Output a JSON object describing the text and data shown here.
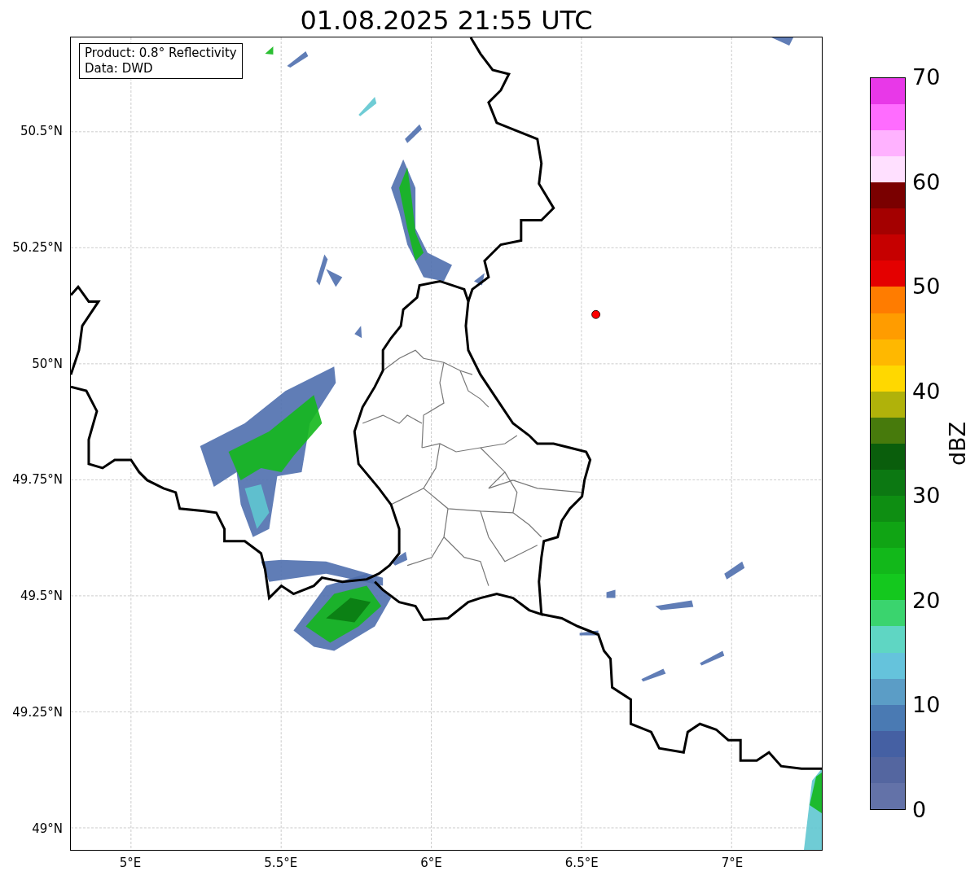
{
  "title": "01.08.2025 21:55 UTC",
  "legend": {
    "lines": [
      "Product: 0.8° Reflectivity",
      "Data: DWD"
    ]
  },
  "map": {
    "lat_labels": [
      "50.5°N",
      "50.25°N",
      "50°N",
      "49.75°N",
      "49.5°N",
      "49.25°N",
      "49°N"
    ],
    "lon_labels": [
      "5°E",
      "5.5°E",
      "6°E",
      "6.5°E",
      "7°E"
    ]
  },
  "colorbar": {
    "label": "dBZ",
    "ticks": [
      "70",
      "60",
      "50",
      "40",
      "30",
      "20",
      "10",
      "0"
    ],
    "bins": [
      {
        "color": "#6372a8"
      },
      {
        "color": "#5466a0"
      },
      {
        "color": "#4560a3"
      },
      {
        "color": "#4a7ab3"
      },
      {
        "color": "#5b9dc6"
      },
      {
        "color": "#65c3dc"
      },
      {
        "color": "#5fd6c3"
      },
      {
        "color": "#3ad46e"
      },
      {
        "color": "#14c81e"
      },
      {
        "color": "#12b81a"
      },
      {
        "color": "#10a414"
      },
      {
        "color": "#0e8e12"
      },
      {
        "color": "#0c7812"
      },
      {
        "color": "#0a5e0c"
      },
      {
        "color": "#477a0c"
      },
      {
        "color": "#b0b20a"
      },
      {
        "color": "#ffd800"
      },
      {
        "color": "#ffb800"
      },
      {
        "color": "#ff9c00"
      },
      {
        "color": "#ff7c00"
      },
      {
        "color": "#e40000"
      },
      {
        "color": "#c60000"
      },
      {
        "color": "#a40000"
      },
      {
        "color": "#7a0000"
      },
      {
        "color": "#ffe0ff"
      },
      {
        "color": "#ffb2ff"
      },
      {
        "color": "#ff6cff"
      },
      {
        "color": "#e838e8"
      }
    ]
  }
}
